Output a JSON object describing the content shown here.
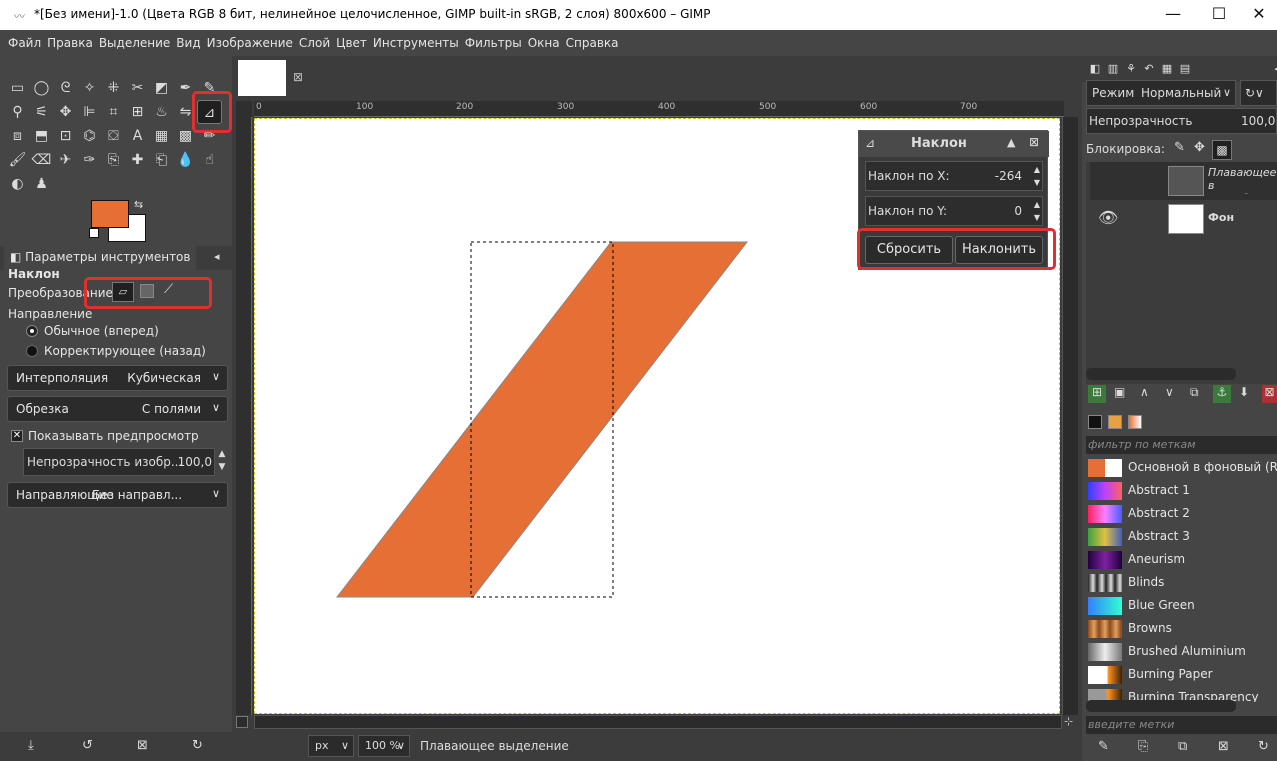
{
  "window": {
    "title": "*[Без имени]-1.0 (Цвета RGB 8 бит, нелинейное целочисленное, GIMP built-in sRGB, 2 слоя) 800x600 – GIMP",
    "minimize": "—",
    "maximize": "☐",
    "close": "✕"
  },
  "menu": [
    "Файл",
    "Правка",
    "Выделение",
    "Вид",
    "Изображение",
    "Слой",
    "Цвет",
    "Инструменты",
    "Фильтры",
    "Окна",
    "Справка"
  ],
  "colors": {
    "foreground": "#e66f35",
    "background": "#ffffff",
    "highlight": "#e03030",
    "shape": "#e66f35"
  },
  "tool_options": {
    "tab_label": "Параметры инструментов",
    "tool_name": "Наклон",
    "transform_label": "Преобразование:",
    "direction_label": "Направление",
    "direction_normal": "Обычное (вперед)",
    "direction_corrective": "Корректирующее (назад)",
    "interpolation_label": "Интерполяция",
    "interpolation_value": "Кубическая",
    "clipping_label": "Обрезка",
    "clipping_value": "С полями",
    "show_preview": "Показывать предпросмотр",
    "image_opacity_label": "Непрозрачность изобр...",
    "image_opacity_value": "100,0",
    "guides_label": "Направляющие",
    "guides_value": "Без направл..."
  },
  "ruler": {
    "h_labels": [
      "0",
      "100",
      "200",
      "300",
      "400",
      "500",
      "600",
      "700"
    ]
  },
  "shear_dialog": {
    "title": "Наклон",
    "shear_x_label": "Наклон по X:",
    "shear_x_value": "-264",
    "shear_y_label": "Наклон по Y:",
    "shear_y_value": "0",
    "reset_button": "Сбросить",
    "apply_button": "Наклонить"
  },
  "statusbar": {
    "unit": "px",
    "zoom": "100 %",
    "message": "Плавающее выделение"
  },
  "layers": {
    "mode_label": "Режим",
    "mode_value": "Нормальный",
    "opacity_label": "Непрозрачность",
    "opacity_value": "100,0",
    "lock_label": "Блокировка:",
    "items": [
      {
        "name": "Плавающее в (Преобразова"
      },
      {
        "name": "Фон"
      }
    ]
  },
  "gradients": {
    "filter_placeholder": "фильтр по меткам",
    "tags_placeholder": "введите метки",
    "items": [
      "Основной в фоновый (R",
      "Abstract 1",
      "Abstract 2",
      "Abstract 3",
      "Aneurism",
      "Blinds",
      "Blue Green",
      "Browns",
      "Brushed Aluminium",
      "Burning Paper",
      "Burning Transparency"
    ]
  }
}
